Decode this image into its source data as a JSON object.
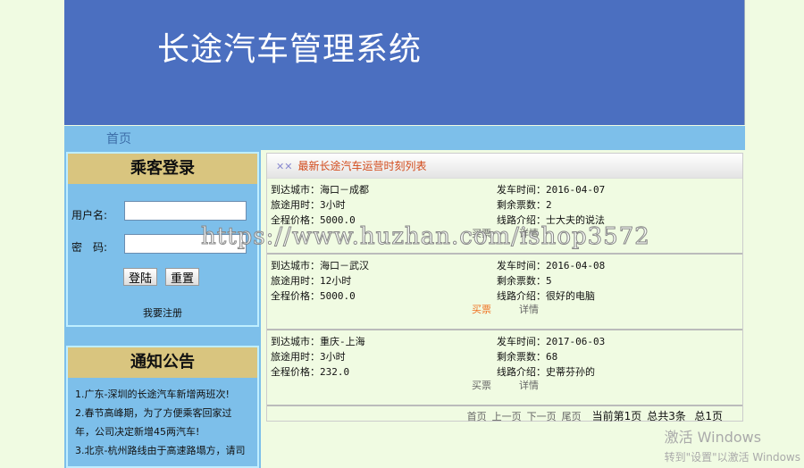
{
  "header": {
    "title": "长途汽车管理系统"
  },
  "nav": {
    "home": "首页"
  },
  "login": {
    "title": "乘客登录",
    "username_label": "用户名:",
    "password_label": "密　码:",
    "username_value": "",
    "password_value": "",
    "login_button": "登陆",
    "reset_button": "重置",
    "register_link": "我要注册"
  },
  "notice": {
    "title": "通知公告",
    "items": [
      "1.广东-深圳的长途汽车新增两班次!",
      "2.春节高峰期，为了方便乘客回家过",
      "年，公司决定新增45两汽车!",
      "3.北京-杭州路线由于高速路塌方，请司"
    ]
  },
  "schedule": {
    "title": "最新长途汽车运营时刻列表",
    "routes": [
      {
        "city": "到达城市：海口－成都",
        "duration": "旅途用时：3小时",
        "price": "全程价格：5000.0",
        "depart": "发车时间：2016-04-07",
        "tickets": "剩余票数：2",
        "intro": "线路介绍：士大夫的说法",
        "buy": "买票",
        "detail": "详情"
      },
      {
        "city": "到达城市：海口－武汉",
        "duration": "旅途用时：12小时",
        "price": "全程价格：5000.0",
        "depart": "发车时间：2016-04-08",
        "tickets": "剩余票数：5",
        "intro": "线路介绍：很好的电脑",
        "buy": "买票",
        "detail": "详情"
      },
      {
        "city": "到达城市：重庆-上海",
        "duration": "旅途用时：3小时",
        "price": "全程价格：232.0",
        "depart": "发车时间：2017-06-03",
        "tickets": "剩余票数：68",
        "intro": "线路介绍：史蒂芬孙的",
        "buy": "买票",
        "detail": "详情"
      }
    ],
    "pager": {
      "first": "首页",
      "prev": "上一页",
      "next": "下一页",
      "last": "尾页",
      "current": "当前第1页",
      "total": "总共3条",
      "pages": "总1页"
    }
  },
  "watermark": "https://www.huzhan.com/ishop3572",
  "activation": {
    "line1": "激活 Windows",
    "line2": "转到\"设置\"以激活 Windows"
  }
}
